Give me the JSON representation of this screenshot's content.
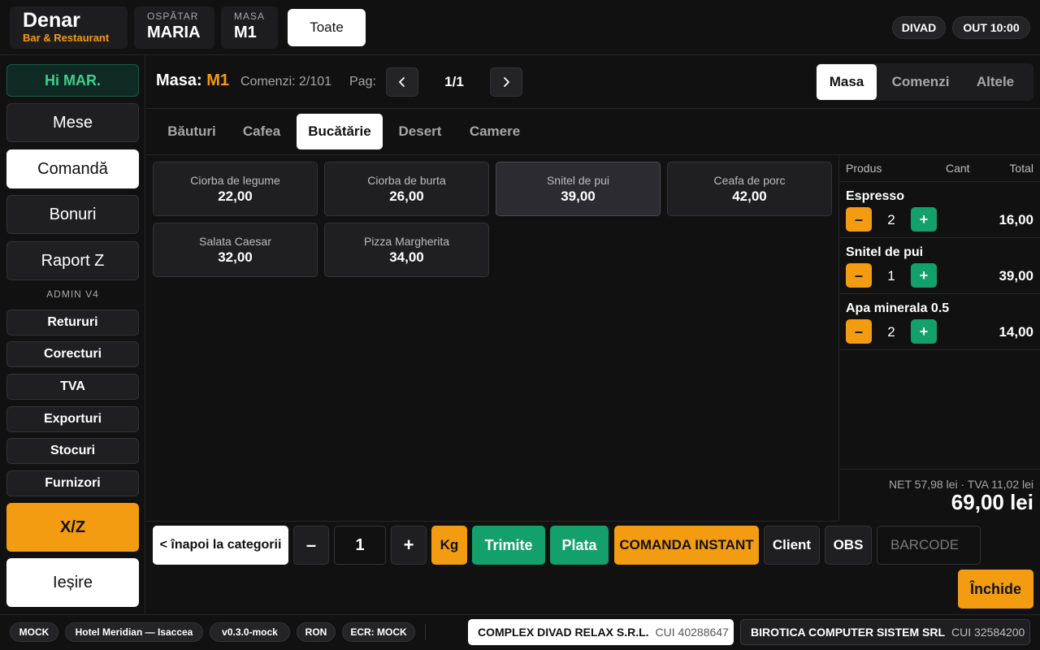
{
  "brand": {
    "name": "Denar",
    "subtitle": "Bar & Restaurant"
  },
  "header": {
    "waiter_label": "OSPĂTAR",
    "waiter_value": "MARIA",
    "table_label": "MASA",
    "table_value": "M1",
    "filter_button": "Toate",
    "user_pill": "DIVAD",
    "clock_pill": "OUT 10:00"
  },
  "sidebar": {
    "greeting": "Hi MAR.",
    "main_items": [
      "Mese",
      "Comandă",
      "Bonuri",
      "Raport Z"
    ],
    "admin_label": "ADMIN V4",
    "admin_items": [
      "Retururi",
      "Corecturi",
      "TVA",
      "Exporturi",
      "Stocuri",
      "Furnizori"
    ],
    "xz_button": "X/Z",
    "exit_button": "Ieșire"
  },
  "main_header": {
    "masa_label": "Masa:",
    "masa_value": "M1",
    "orders_text": "Comenzi: 2/101",
    "page_label": "Pag:",
    "page_value": "1/1",
    "prev_icon": "chevron-left-icon",
    "next_icon": "chevron-right-icon",
    "view_tabs": [
      "Masa",
      "Comenzi",
      "Altele"
    ],
    "active_view": "Masa"
  },
  "categories": {
    "items": [
      "Băuturi",
      "Cafea",
      "Bucătărie",
      "Desert",
      "Camere"
    ],
    "active": "Bucătărie"
  },
  "products": [
    {
      "name": "Ciorba de legume",
      "price": "22,00"
    },
    {
      "name": "Ciorba de burta",
      "price": "26,00"
    },
    {
      "name": "Snitel de pui",
      "price": "39,00"
    },
    {
      "name": "Ceafa de porc",
      "price": "42,00"
    },
    {
      "name": "Salata Caesar",
      "price": "32,00"
    },
    {
      "name": "Pizza Margherita",
      "price": "34,00"
    }
  ],
  "order": {
    "headers": {
      "product": "Produs",
      "qty": "Cant",
      "total": "Total"
    },
    "items": [
      {
        "name": "Espresso",
        "qty": "2",
        "total": "16,00"
      },
      {
        "name": "Snitel de pui",
        "qty": "1",
        "total": "39,00"
      },
      {
        "name": "Apa minerala 0.5",
        "qty": "2",
        "total": "14,00"
      }
    ],
    "minus_symbol": "–",
    "plus_symbol": "+",
    "net_vat": "NET 57,98 lei · TVA 11,02 lei",
    "grand_total": "69,00 lei"
  },
  "actions": {
    "back": "< înapoi la categorii",
    "minus": "–",
    "qty": "1",
    "plus": "+",
    "kg": "Kg",
    "send": "Trimite",
    "pay": "Plata",
    "instant": "COMANDA INSTANT",
    "client": "Client",
    "obs": "OBS",
    "barcode_placeholder": "BARCODE",
    "close": "Închide"
  },
  "footer": {
    "tags": [
      "MOCK",
      "Hotel Meridian — Isaccea",
      "v0.3.0-mock",
      "RON",
      "ECR: MOCK"
    ],
    "company1_name": "COMPLEX DIVAD RELAX S.R.L.",
    "company1_cui": "CUI 40288647",
    "company2_name": "BIROTICA COMPUTER SISTEM SRL",
    "company2_cui": "CUI 32584200"
  },
  "colors": {
    "accent_orange": "#f39c12",
    "accent_green": "#14a06a",
    "background": "#111112",
    "panel": "#1f1f21"
  }
}
